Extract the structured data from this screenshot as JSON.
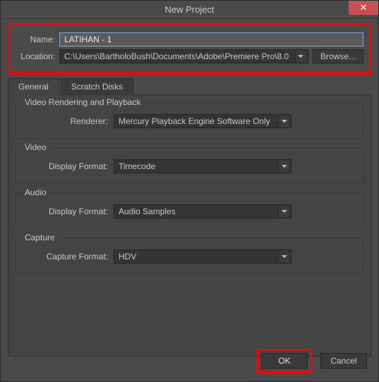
{
  "titlebar": {
    "title": "New Project",
    "close": "✕"
  },
  "top": {
    "name_label": "Name:",
    "name_value": "LATIHAN - 1",
    "location_label": "Location:",
    "location_value": "C:\\Users\\BartholoBush\\Documents\\Adobe\\Premiere Pro\\8.0",
    "browse": "Browse..."
  },
  "tabs": {
    "general": "General",
    "scratch": "Scratch Disks"
  },
  "groups": {
    "video_rendering": {
      "title": "Video Rendering and Playback",
      "renderer_label": "Renderer:",
      "renderer_value": "Mercury Playback Engine Software Only"
    },
    "video": {
      "title": "Video",
      "display_format_label": "Display Format:",
      "display_format_value": "Timecode"
    },
    "audio": {
      "title": "Audio",
      "display_format_label": "Display Format:",
      "display_format_value": "Audio Samples"
    },
    "capture": {
      "title": "Capture",
      "capture_format_label": "Capture Format:",
      "capture_format_value": "HDV"
    }
  },
  "buttons": {
    "ok": "OK",
    "cancel": "Cancel"
  }
}
